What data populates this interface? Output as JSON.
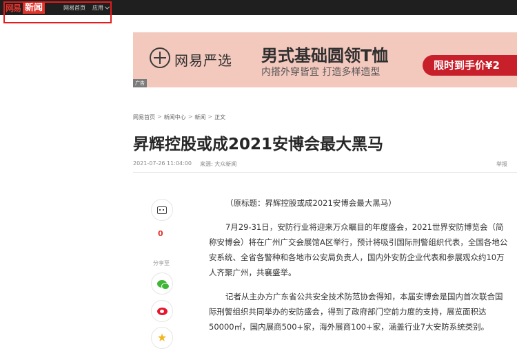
{
  "topbar": {
    "logo_netease": "网易",
    "logo_news": "新闻",
    "nav_home": "网易首页",
    "nav_apps": "应用"
  },
  "ad": {
    "brand": "网易严选",
    "title": "男式基础圆领T恤",
    "subtitle": "内搭外穿皆宜 打造多样造型",
    "cta": "限时到手价¥2",
    "tag": "广告"
  },
  "breadcrumb": [
    "网易首页",
    "新闻中心",
    "新闻",
    "正文"
  ],
  "breadcrumb_sep": ">",
  "article": {
    "title": "昇辉控股或成2021安博会最大黑马",
    "datetime": "2021-07-26 11:04:00",
    "source": "来源: 大众新闻",
    "report": "举报",
    "paragraphs": [
      "（原标题：昇辉控股或成2021安博会最大黑马）",
      "7月29-31日，安防行业将迎来万众瞩目的年度盛会，2021世界安防博览会（简称安博会）将在广州广交会展馆A区举行，预计将吸引国际刑警组织代表，全国各地公安系统、全省各警种和各地市公安局负责人，国内外安防企业代表和参展观众约10万人齐聚广州，共襄盛举。",
      "记者从主办方广东省公共安全技术防范协会得知，本届安博会是国内首次联合国际刑警组织共同举办的安防盛会，得到了政府部门空前力度的支持，展览面积达50000㎡，国内展商500+家，海外展商100+家，涵盖行业7大安防系统类别。"
    ]
  },
  "share": {
    "comment_count": "0",
    "share_label": "分享至",
    "icons": [
      "comment-icon",
      "wechat-icon",
      "weibo-icon",
      "qzone-icon"
    ]
  },
  "colors": {
    "brand_red": "#e0352c",
    "topbar_bg": "#1f1f1f",
    "ad_bg": "#f3c8bd",
    "highlight": "#e41b1b"
  }
}
